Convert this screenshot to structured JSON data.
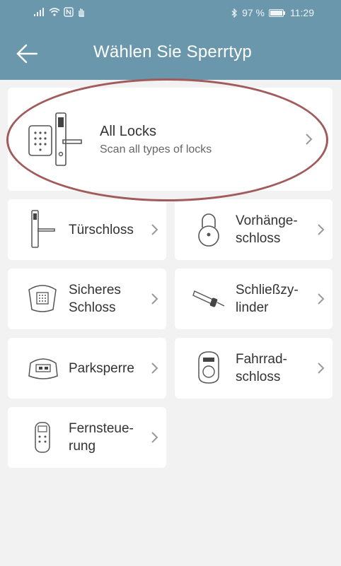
{
  "status_bar": {
    "battery": "97 %",
    "time": "11:29"
  },
  "header": {
    "title": "Wählen Sie Sperrtyp"
  },
  "all_locks": {
    "title": "All Locks",
    "subtitle": "Scan all types of locks"
  },
  "lock_types": [
    {
      "label": "Türschloss"
    },
    {
      "label": "Vorhänge-\nschloss"
    },
    {
      "label": "Sicheres\nSchloss"
    },
    {
      "label": "Schließzy-\nlinder"
    },
    {
      "label": "Parksperre"
    },
    {
      "label": "Fahrrad-\nschloss"
    },
    {
      "label": "Fernsteue-\nrung"
    }
  ],
  "colors": {
    "header": "#6b97ac",
    "background": "#f2f2f2",
    "highlight": "#a15b5b"
  }
}
